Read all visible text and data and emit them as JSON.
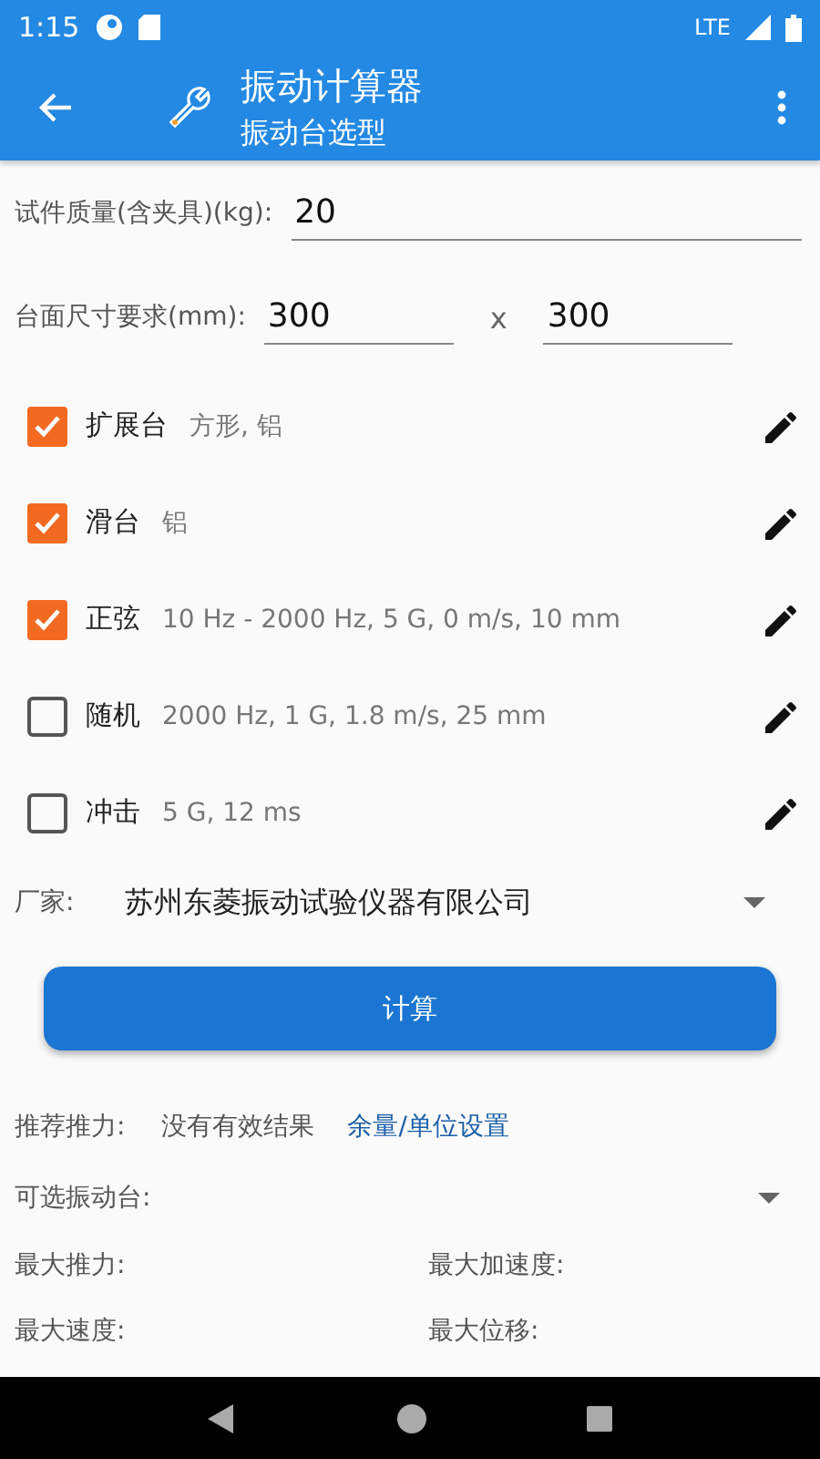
{
  "status_bar": {
    "time": "1:15",
    "network": "LTE"
  },
  "app_bar": {
    "title": "振动计算器",
    "subtitle": "振动台选型"
  },
  "mass_field": {
    "label": "试件质量(含夹具)(kg):",
    "value": "20"
  },
  "size_field": {
    "label": "台面尺寸要求(mm):",
    "value_1": "300",
    "separator": "x",
    "value_2": "300"
  },
  "options": [
    {
      "label": "扩展台",
      "detail": "方形, 铝",
      "checked": true
    },
    {
      "label": "滑台",
      "detail": "铝",
      "checked": true
    },
    {
      "label": "正弦",
      "detail": "10 Hz - 2000 Hz, 5 G, 0 m/s, 10 mm",
      "checked": true
    },
    {
      "label": "随机",
      "detail": "2000 Hz, 1 G, 1.8 m/s, 25 mm",
      "checked": false
    },
    {
      "label": "冲击",
      "detail": "5 G, 12 ms",
      "checked": false
    }
  ],
  "manufacturer": {
    "label": "厂家:",
    "value": "苏州东菱振动试验仪器有限公司"
  },
  "calculate_button": "计算",
  "recommend": {
    "label": "推荐推力:",
    "value": "没有有效结果",
    "link": "余量/单位设置"
  },
  "selectable": {
    "label": "可选振动台:"
  },
  "results": [
    "最大推力:",
    "最大加速度:",
    "最大速度:",
    "最大位移:"
  ]
}
